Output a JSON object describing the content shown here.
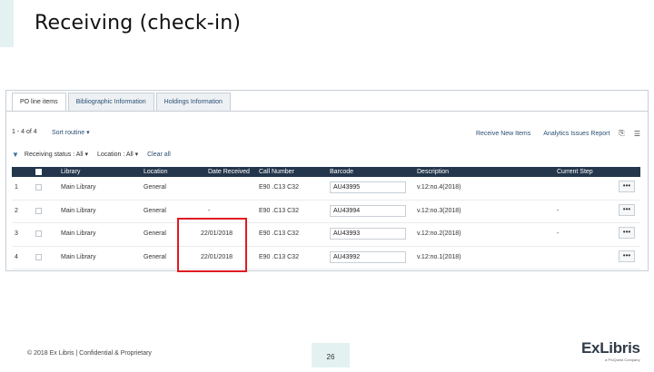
{
  "slide": {
    "title": "Receiving (check-in)",
    "footer": "© 2018 Ex Libris | Confidential & Proprietary",
    "page_number": "26",
    "logo_text": "ExLibris",
    "logo_subtext": "a ProQuest Company"
  },
  "tabs": [
    {
      "label": "PO line items",
      "active": true
    },
    {
      "label": "Bibliographic Information",
      "active": false
    },
    {
      "label": "Holdings Information",
      "active": false
    }
  ],
  "toolbar": {
    "count": "1 - 4 of 4",
    "sort": "Sort routine ▾",
    "receive_new": "Receive New Items",
    "analytics": "Analytics Issues Report",
    "icons": [
      "export-icon",
      "list-icon"
    ]
  },
  "filters": {
    "receiving_status": "Receiving status : All ▾",
    "location": "Location : All ▾",
    "clear_all": "Clear all"
  },
  "table": {
    "columns": [
      "Library",
      "Location",
      "Date Received",
      "Call Number",
      "Barcode",
      "Description",
      "Current Step"
    ],
    "rows": [
      {
        "num": "1",
        "library": "Main Library",
        "location": "General",
        "date_received": "",
        "call_number": "E90 .C13 C32",
        "barcode": "AU43995",
        "description": "v.12:no.4(2018)",
        "current_step": "",
        "action": "•••"
      },
      {
        "num": "2",
        "library": "Main Library",
        "location": "General",
        "date_received": "-",
        "call_number": "E90 .C13 C32",
        "barcode": "AU43994",
        "description": "v.12:no.3(2018)",
        "current_step": "-",
        "action": "•••"
      },
      {
        "num": "3",
        "library": "Main Library",
        "location": "General",
        "date_received": "22/01/2018",
        "call_number": "E90 .C13 C32",
        "barcode": "AU43993",
        "description": "v.12:no.2(2018)",
        "current_step": "-",
        "action": "•••"
      },
      {
        "num": "4",
        "library": "Main Library",
        "location": "General",
        "date_received": "22/01/2018",
        "call_number": "E90 .C13 C32",
        "barcode": "AU43992",
        "description": "v.12:no.1(2018)",
        "current_step": "",
        "action": "•••"
      }
    ]
  },
  "colors": {
    "header_bg": "#23364b",
    "highlight": "#e01b22",
    "accent": "#e3f1f1",
    "link": "#2a4f73"
  }
}
